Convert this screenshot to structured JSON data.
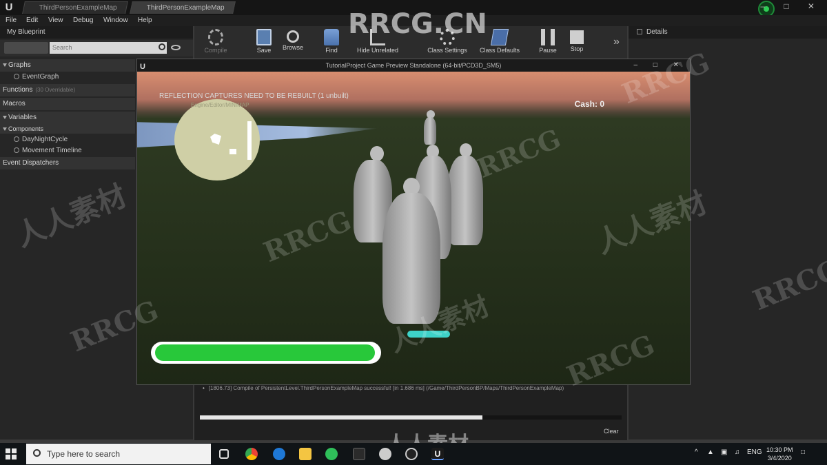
{
  "window": {
    "tabs": [
      "ThirdPersonExampleMap",
      "ThirdPersonExampleMap"
    ],
    "controls": "– □ ✕",
    "watermark_top": "RRCG.CN"
  },
  "menu": [
    "File",
    "Edit",
    "View",
    "Debug",
    "Window",
    "Help"
  ],
  "left_panel": {
    "title": "My Blueprint",
    "search_placeholder": "Search",
    "graphs": "Graphs",
    "event_graph": "EventGraph",
    "functions": "Functions",
    "functions_overridable": "(30 Overridable)",
    "macros": "Macros",
    "variables": "Variables",
    "components": "Components",
    "component_items": [
      "DayNightCycle",
      "Movement Timeline"
    ],
    "event_dispatchers": "Event Dispatchers"
  },
  "toolbar": {
    "compile": "Compile",
    "save": "Save",
    "browse": "Browse",
    "find": "Find",
    "hide_unrelated": "Hide Unrelated",
    "class_settings": "Class Settings",
    "class_defaults": "Class Defaults",
    "pause": "Pause",
    "stop": "Stop",
    "more": "»"
  },
  "details": {
    "title": "Details"
  },
  "preview": {
    "title": "TutorialProject Game Preview Standalone (64-bit/PCD3D_SM5)",
    "controls": "– □ ✕",
    "message": "REFLECTION CAPTURES NEED TO BE REBUILT (1 unbuilt)",
    "cash": "Cash: 0",
    "minimap_label": "Engine/Editor/MINIMAP",
    "health_fraction": 0.99,
    "stamina_fraction": 1.0
  },
  "log": {
    "line": "[1806.73] Compile of PersistentLevel.ThirdPersonExampleMap successful! [in 1.686 ms] (/Game/ThirdPersonBP/Maps/ThirdPersonExampleMap)",
    "progress_fraction": 0.67,
    "clear": "Clear"
  },
  "watermarks": {
    "latin": "RRCG",
    "cjk": "人人素材"
  },
  "taskbar": {
    "search_placeholder": "Type here to search",
    "language": "ENG",
    "time": "10:30 PM",
    "date": "3/4/2020",
    "icons": [
      "task-view-icon",
      "chrome-icon",
      "edge-icon",
      "file-explorer-icon",
      "whatsapp-icon",
      "unreal-icon"
    ]
  }
}
